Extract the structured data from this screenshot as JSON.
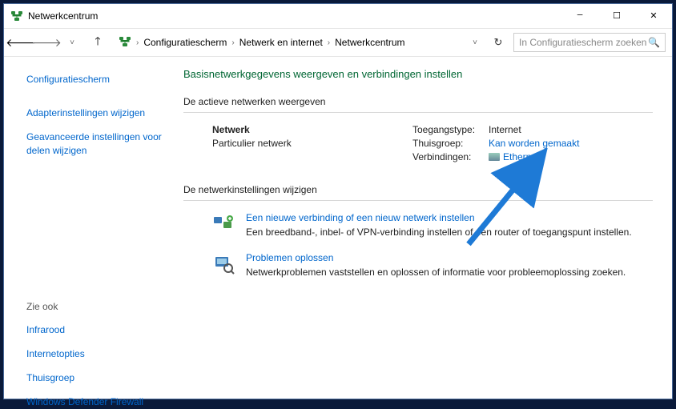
{
  "window": {
    "title": "Netwerkcentrum"
  },
  "nav": {
    "crumbs": [
      "Configuratiescherm",
      "Netwerk en internet",
      "Netwerkcentrum"
    ],
    "search_placeholder": "In Configuratiescherm zoeken"
  },
  "sidebar": {
    "items": [
      {
        "label": "Configuratiescherm"
      },
      {
        "label": "Adapterinstellingen wijzigen"
      },
      {
        "label": "Geavanceerde instellingen voor delen wijzigen"
      }
    ],
    "seealso_header": "Zie ook",
    "seealso": [
      {
        "label": "Infrarood"
      },
      {
        "label": "Internetopties"
      },
      {
        "label": "Thuisgroep"
      },
      {
        "label": "Windows Defender Firewall"
      }
    ]
  },
  "main": {
    "heading": "Basisnetwerkgegevens weergeven en verbindingen instellen",
    "active_header": "De actieve netwerken weergeven",
    "network": {
      "name": "Netwerk",
      "type": "Particulier netwerk"
    },
    "props": {
      "access_label": "Toegangstype:",
      "access_value": "Internet",
      "homegroup_label": "Thuisgroep:",
      "homegroup_value": "Kan worden gemaakt",
      "conn_label": "Verbindingen:",
      "conn_value": "Ethernet"
    },
    "change_header": "De netwerkinstellingen wijzigen",
    "tasks": [
      {
        "title": "Een nieuwe verbinding of een nieuw netwerk instellen",
        "desc": "Een breedband-, inbel- of VPN-verbinding instellen of een router of toegangspunt instellen."
      },
      {
        "title": "Problemen oplossen",
        "desc": "Netwerkproblemen vaststellen en oplossen of informatie voor probleemoplossing zoeken."
      }
    ]
  }
}
